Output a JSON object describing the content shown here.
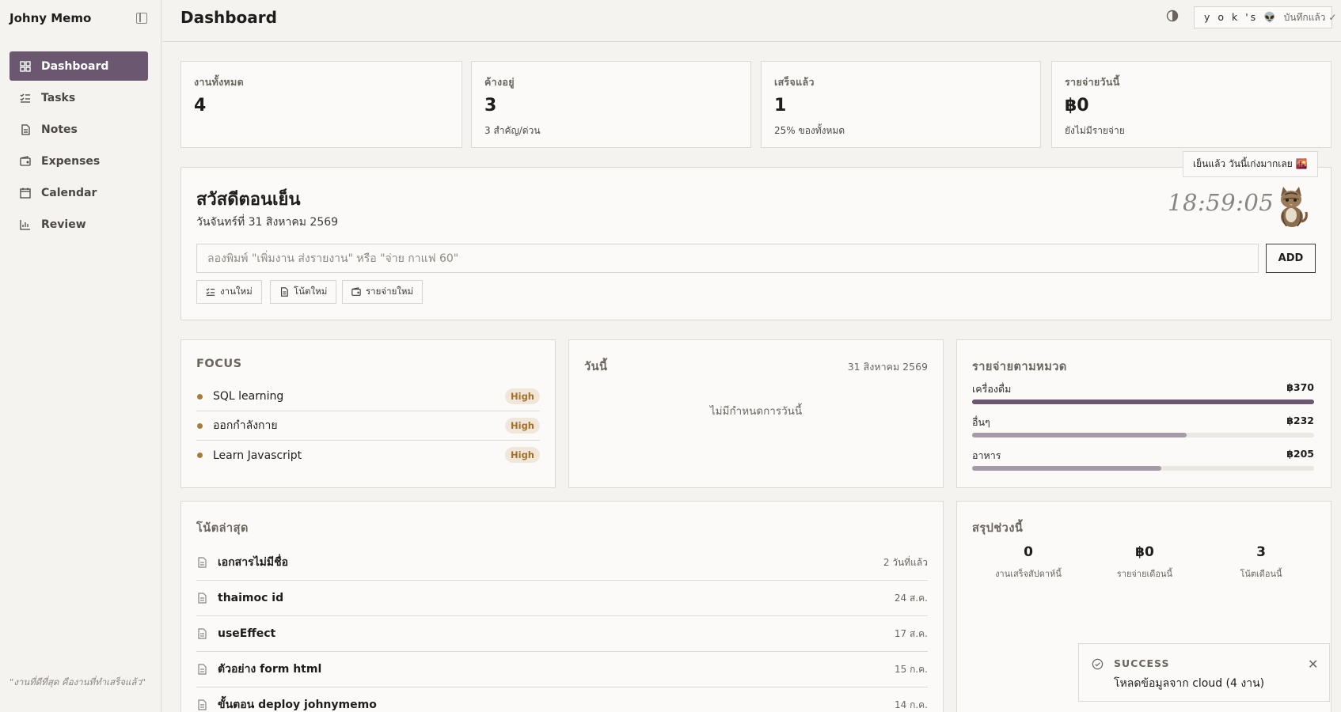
{
  "app": {
    "brand": "Johny Memo",
    "page_title": "Dashboard"
  },
  "sidebar": {
    "items": [
      {
        "label": "Dashboard",
        "icon": "grid-icon",
        "active": true
      },
      {
        "label": "Tasks",
        "icon": "checklist-icon",
        "active": false
      },
      {
        "label": "Notes",
        "icon": "document-icon",
        "active": false
      },
      {
        "label": "Expenses",
        "icon": "wallet-icon",
        "active": false
      },
      {
        "label": "Calendar",
        "icon": "calendar-icon",
        "active": false
      },
      {
        "label": "Review",
        "icon": "bar-chart-icon",
        "active": false
      }
    ],
    "quote": "\"งานที่ดีที่สุด คืองานที่ทำเสร็จแล้ว\""
  },
  "header": {
    "user_name": "y o k 's 👽",
    "save_status": "บันทึกแล้ว ✓"
  },
  "stats": [
    {
      "label": "งานทั้งหมด",
      "value": "4",
      "sub": ""
    },
    {
      "label": "ค้างอยู่",
      "value": "3",
      "sub": "3 สำคัญ/ด่วน"
    },
    {
      "label": "เสร็จแล้ว",
      "value": "1",
      "sub": "25% ของทั้งหมด"
    },
    {
      "label": "รายจ่ายวันนี้",
      "value": "฿0",
      "sub": "ยังไม่มีรายจ่าย"
    }
  ],
  "greeting": {
    "title": "สวัสดีตอนเย็น",
    "date": "วันจันทร์ที่ 31 สิงหาคม 2569",
    "clock": "18:59:05",
    "tag": "เย็นแล้ว วันนี้เก่งมากเลย 🌇",
    "input_placeholder": "ลองพิมพ์ \"เพิ่มงาน ส่งรายงาน\" หรือ \"จ่าย กาแฟ 60\"",
    "add_label": "ADD",
    "quick_buttons": [
      {
        "label": "งานใหม่",
        "icon": "checklist-icon"
      },
      {
        "label": "โน้ตใหม่",
        "icon": "document-icon"
      },
      {
        "label": "รายจ่ายใหม่",
        "icon": "wallet-icon"
      }
    ]
  },
  "focus": {
    "title": "FOCUS",
    "items": [
      {
        "text": "SQL learning",
        "priority": "High"
      },
      {
        "text": "ออกกำลังกาย",
        "priority": "High"
      },
      {
        "text": "Learn Javascript",
        "priority": "High"
      }
    ]
  },
  "today": {
    "title": "วันนี้",
    "date": "31 สิงหาคม 2569",
    "empty_text": "ไม่มีกำหนดการวันนี้"
  },
  "expense_categories": {
    "title": "รายจ่ายตามหมวด",
    "items": [
      {
        "name": "เครื่องดื่ม",
        "amount": "฿370",
        "fraction": 1.0,
        "color": "#6b5870"
      },
      {
        "name": "อื่นๆ",
        "amount": "฿232",
        "fraction": 0.627,
        "color": "#a79aa8"
      },
      {
        "name": "อาหาร",
        "amount": "฿205",
        "fraction": 0.554,
        "color": "#a79aa8"
      }
    ]
  },
  "notes": {
    "title": "โน้ตล่าสุด",
    "items": [
      {
        "title": "เอกสารไม่มีชื่อ",
        "date": "2 วันที่แล้ว"
      },
      {
        "title": "thaimoc id",
        "date": "24 ส.ค."
      },
      {
        "title": "useEffect",
        "date": "17 ส.ค."
      },
      {
        "title": "ตัวอย่าง form html",
        "date": "15 ก.ค."
      },
      {
        "title": "ขั้นตอน deploy johnymemo",
        "date": "14 ก.ค."
      }
    ]
  },
  "summary": {
    "title": "สรุปช่วงนี้",
    "items": [
      {
        "value": "0",
        "label": "งานเสร็จสัปดาห์นี้"
      },
      {
        "value": "฿0",
        "label": "รายจ่ายเดือนนี้"
      },
      {
        "value": "3",
        "label": "โน้ตเดือนนี้"
      }
    ]
  },
  "toast": {
    "title": "SUCCESS",
    "message": "โหลดข้อมูลจาก cloud (4 งาน)"
  }
}
